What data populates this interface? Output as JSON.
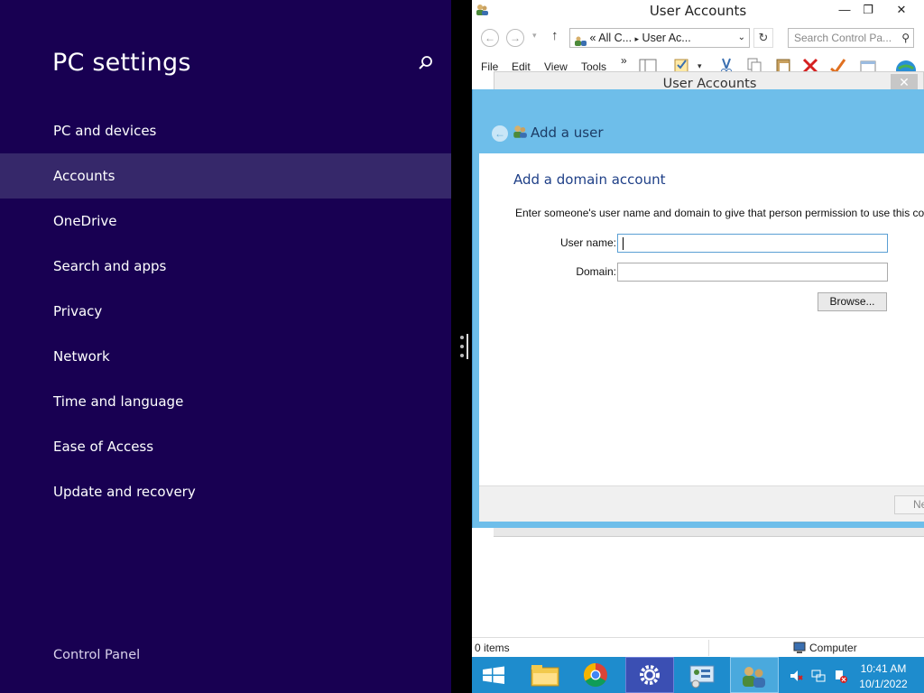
{
  "pc_settings": {
    "title": "PC settings",
    "nav_items": [
      {
        "label": "PC and devices"
      },
      {
        "label": "Accounts"
      },
      {
        "label": "OneDrive"
      },
      {
        "label": "Search and apps"
      },
      {
        "label": "Privacy"
      },
      {
        "label": "Network"
      },
      {
        "label": "Time and language"
      },
      {
        "label": "Ease of Access"
      },
      {
        "label": "Update and recovery"
      }
    ],
    "selected": "Accounts",
    "footer_link": "Control Panel",
    "colors": {
      "background": "#180052",
      "selected": "#36286a"
    }
  },
  "explorer": {
    "title": "User Accounts",
    "address": {
      "prefix": "«",
      "crumb1": "All C...",
      "crumb2": "User Ac...",
      "separator": "▸"
    },
    "search_placeholder": "Search Control Pa...",
    "menu": {
      "file": "File",
      "edit": "Edit",
      "view": "View",
      "tools": "Tools",
      "more": "»"
    },
    "status": {
      "items": "0 items",
      "location": "Computer"
    }
  },
  "dialog": {
    "window_title": "User Accounts",
    "header_title": "Add a user",
    "heading": "Add a domain account",
    "description": "Enter someone's user name and domain to give that person permission to use this cor",
    "username_label": "User name:",
    "username_value": "",
    "domain_label": "Domain:",
    "domain_value": "",
    "browse_label": "Browse...",
    "next_label": "Ne",
    "colors": {
      "frame": "#6ebeea",
      "heading": "#1e3f87"
    }
  },
  "taskbar": {
    "time": "10:41 AM",
    "date": "10/1/2022",
    "color": "#1e8ccd"
  }
}
